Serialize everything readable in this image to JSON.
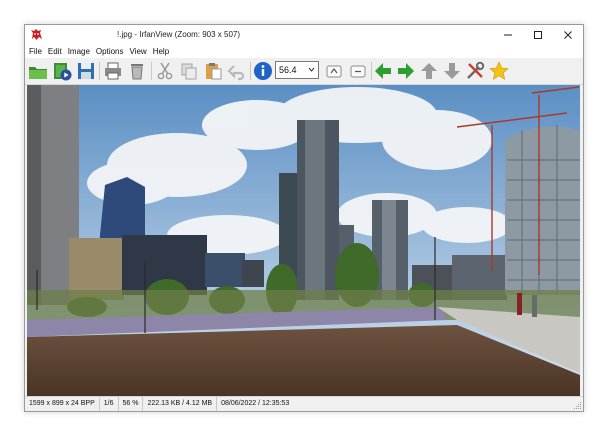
{
  "window": {
    "title": "!.jpg - IrfanView (Zoom: 903 x 507)",
    "app_icon": "irfanview-red-cat-icon",
    "controls": [
      "minimize-icon",
      "maximize-icon",
      "close-icon"
    ]
  },
  "menu": {
    "items": [
      {
        "label": "File"
      },
      {
        "label": "Edit"
      },
      {
        "label": "Image"
      },
      {
        "label": "Options"
      },
      {
        "label": "View"
      },
      {
        "label": "Help"
      }
    ]
  },
  "toolbar": {
    "zoom_value": "56.4",
    "icons": [
      "open-folder-icon",
      "slideshow-icon",
      "save-icon",
      "print-icon",
      "cut-icon",
      "copy-icon",
      "paste-icon",
      "undo-icon",
      "info-icon",
      "zoom-in-icon",
      "zoom-out-icon",
      "previous-icon",
      "next-icon",
      "first-icon",
      "last-icon",
      "properties-tools-icon",
      "favorite-star-icon"
    ]
  },
  "status": {
    "dimensions": "1599 x 899 x 24 BPP",
    "page": "1/6",
    "zoom": "56 %",
    "size": "222.13 KB / 4.12 MB",
    "datetime": "08/06/2022 / 12:35:53"
  },
  "colors": {
    "nav_green": "#2e9e2e",
    "nav_gray": "#9a9a9a",
    "info_blue": "#1f63c9",
    "star_yellow": "#f2c40f"
  }
}
